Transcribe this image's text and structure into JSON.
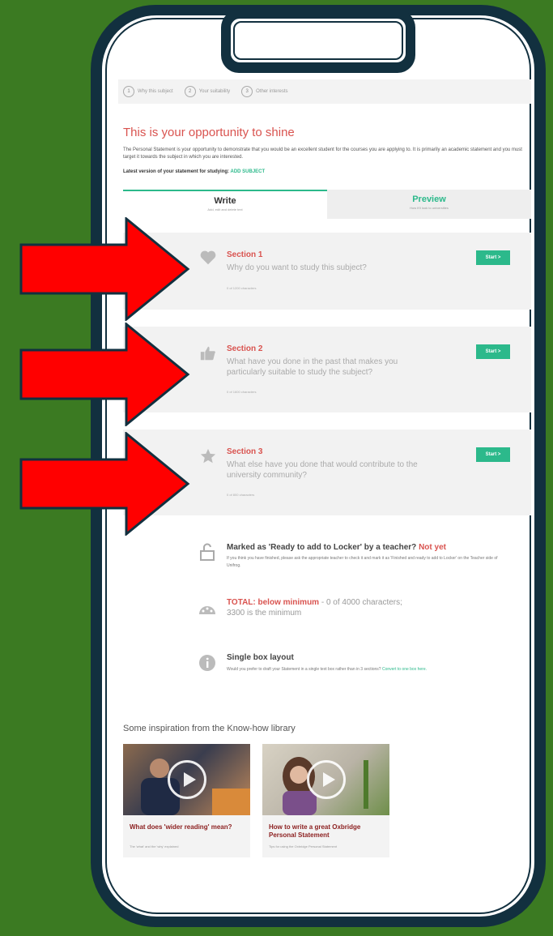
{
  "steps": [
    {
      "num": "1",
      "label": "Why this subject"
    },
    {
      "num": "2",
      "label": "Your suitability"
    },
    {
      "num": "3",
      "label": "Other interests"
    }
  ],
  "headline": "This is your opportunity to shine",
  "intro": "The Personal Statement is your opportunity to demonstrate that you would be an excellent student for the courses you are applying to. It is primarily an academic statement and you must target it towards the subject in which you are interested.",
  "latest": {
    "label": "Latest version of your statement for studying:",
    "link": "ADD SUBJECT"
  },
  "tabs": [
    {
      "title": "Write",
      "sub": "Add, edit and delete text"
    },
    {
      "title": "Preview",
      "sub": "How it'll look to universities"
    }
  ],
  "sections": [
    {
      "title": "Section 1",
      "question": "Why do you want to study this subject?",
      "count": "0 of 1200 characters",
      "button": "Start >",
      "icon": "heart-icon"
    },
    {
      "title": "Section 2",
      "question": "What have you done in the past that makes you particularly suitable to study the subject?",
      "count": "0 of 1600 characters",
      "button": "Start >",
      "icon": "thumbs-up-icon"
    },
    {
      "title": "Section 3",
      "question": "What else have you done that would contribute to the university community?",
      "count": "0 of 800 characters",
      "button": "Start >",
      "icon": "star-icon"
    }
  ],
  "locker": {
    "title": "Marked as 'Ready to add to Locker' by a teacher?",
    "status": "Not yet",
    "sub": "If you think you have finished, please ask the appropriate teacher to check it and mark it as 'Finished and ready to add to Locker' on the Teacher side of Unifrog."
  },
  "total": {
    "label": "TOTAL: below minimum",
    "rest": " - 0 of 4000 characters;",
    "line2": "3300 is the minimum"
  },
  "single_box": {
    "title": "Single box layout",
    "sub": "Would you prefer to draft your Statement in a single text box rather than in 3 sections?",
    "link": "Convert to one box here."
  },
  "inspiration": {
    "title": "Some inspiration from the Know-how library",
    "cards": [
      {
        "title": "What does 'wider reading' mean?",
        "sub": "The 'what' and the 'why' explained"
      },
      {
        "title": "How to write a great Oxbridge Personal Statement",
        "sub": "Tips for using the Oxbridge Personal Statement"
      }
    ]
  },
  "colors": {
    "background": "#3b7a22",
    "frame": "#12303f",
    "accent_red": "#d9534f",
    "accent_green": "#2cb98b",
    "arrow": "#ff0000"
  }
}
